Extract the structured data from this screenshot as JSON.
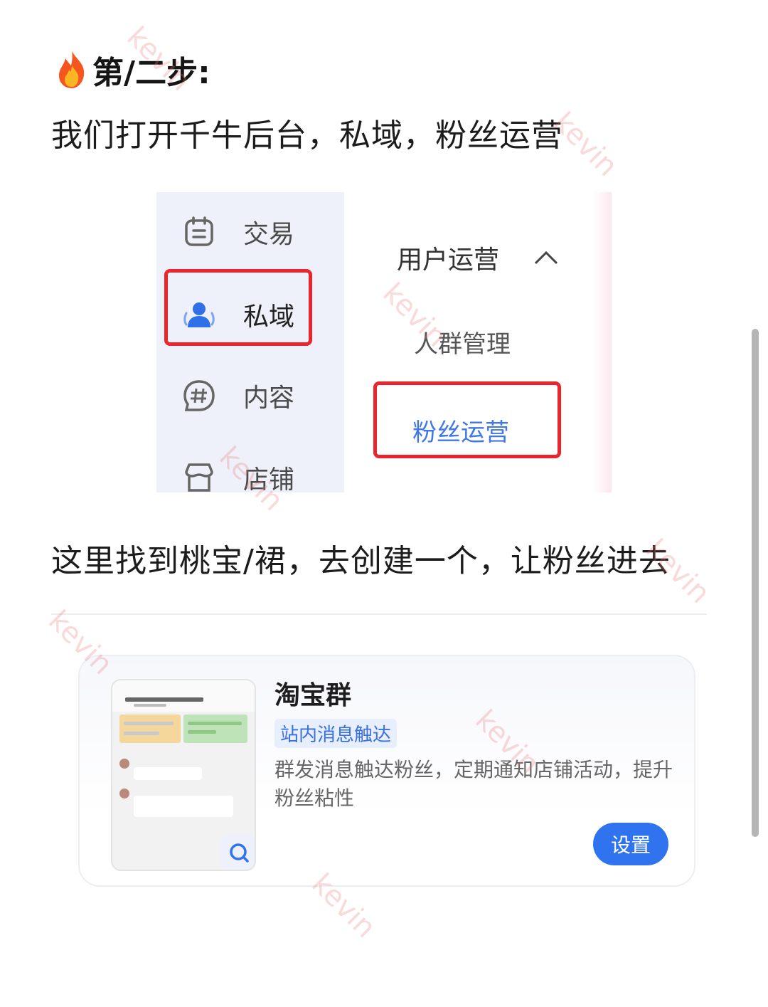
{
  "step": {
    "title": "第/二步:",
    "icon": "fire-icon"
  },
  "intro": "我们打开千牛后台，私域，粉丝运营",
  "menu": {
    "sidebar": [
      {
        "label": "交易",
        "icon": "notepad-icon"
      },
      {
        "label": "私域",
        "icon": "people-icon",
        "highlighted": true
      },
      {
        "label": "内容",
        "icon": "hashtag-icon"
      },
      {
        "label": "店铺",
        "icon": "shop-icon"
      }
    ],
    "section": "用户运营",
    "items": [
      "人群管理",
      "粉丝运营"
    ],
    "active_color": "#3f77e8",
    "highlight_color": "#e8262b"
  },
  "instruction": "这里找到桃宝/裙，去创建一个，让粉丝进去",
  "card": {
    "title": "淘宝群",
    "tag": "站内消息触达",
    "description": "群发消息触达粉丝，定期通知店铺活动，提升粉丝粘性",
    "button": "设置",
    "button_color": "#2f74ee"
  },
  "watermark": "kevin"
}
